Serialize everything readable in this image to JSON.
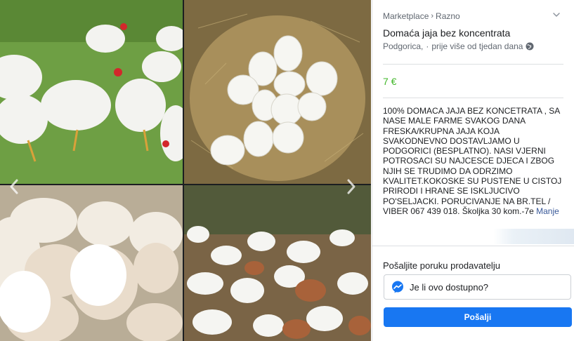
{
  "breadcrumb": {
    "root": "Marketplace",
    "separator": "›",
    "category": "Razno"
  },
  "listing": {
    "title": "Domaća jaja bez koncentrata",
    "location": "Podgorica,",
    "dot": "·",
    "posted": "prije više od tjedan dana",
    "price": "7 €",
    "description": "100% DOMACA JAJA BEZ KONCETRATA , SA NASE MALE FARME SVAKOG DANA FRESKA/KRUPNA JAJA KOJA SVAKODNEVNO DOSTAVLJAMO U PODGORICI (BESPLATNO). NASI VJERNI POTROSACI SU NAJCESCE DJECA I ZBOG NJIH SE TRUDIMO DA ODRZIMO KVALITET.KOKOSKE SU PUSTENE U CISTOJ PRIRODI I HRANE SE ISKLJUCIVO PO'SELJACKI. PORUCIVANJE NA BR.TEL / VIBER 067 439 018. Školjka 30 kom.-7e",
    "more_link": "Manje"
  },
  "message": {
    "label": "Pošaljite poruku prodavatelju",
    "input_value": "Je li ovo dostupno?",
    "send_label": "Pošalji"
  },
  "icons": {
    "prev": "chevron-left-icon",
    "next": "chevron-right-icon",
    "collapse": "chevron-down-icon",
    "globe": "globe-icon",
    "messenger": "messenger-icon"
  },
  "colors": {
    "price": "#42b72a",
    "button": "#1877f2",
    "link": "#385898",
    "muted_text": "#606770"
  }
}
